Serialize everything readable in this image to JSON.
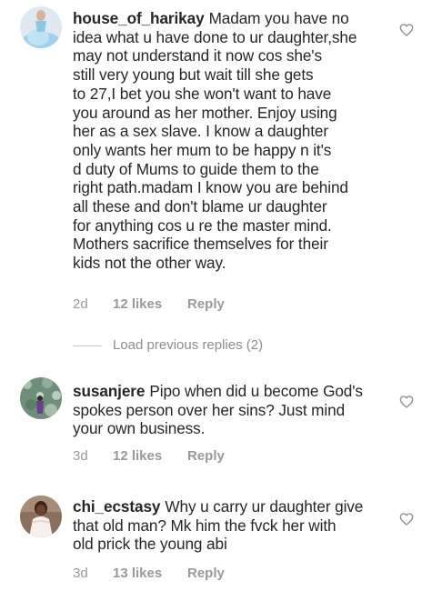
{
  "comments": [
    {
      "username": "house_of_harikay",
      "lines": [
        "Madam you have no",
        "idea what u have done to ur daughter,she",
        "may not understand it now cos she's",
        "still very young but wait till she gets",
        "to 27,I bet you she won't want to have",
        "you around as her mother. Enjoy using",
        "her as a sex slave. I know a daughter",
        "only wants her mum to be happy n it's",
        "d duty of Mums to guide them to the",
        "right path.madam I know you are behind",
        "all these and don't blame ur daughter",
        "for anything cos u re the master mind.",
        "Mothers sacrifice themselves for their",
        "kids not the other way."
      ],
      "time": "2d",
      "likes": "12 likes",
      "reply": "Reply",
      "avatar": "avatar-blue-gown",
      "heart_icon": "heart-outline-icon"
    },
    {
      "username": "susanjere",
      "lines": [
        "Pipo when did u become God's",
        "spokes person over her sins? Just mind",
        "your own business."
      ],
      "time": "3d",
      "likes": "12 likes",
      "reply": "Reply",
      "avatar": "avatar-floral",
      "heart_icon": "heart-outline-icon"
    },
    {
      "username": "chi_ecstasy",
      "lines": [
        "Why u carry ur daughter give",
        "that old man? Mk him the fvck her with",
        "old prick the young abi"
      ],
      "time": "3d",
      "likes": "13 likes",
      "reply": "Reply",
      "avatar": "avatar-white-dress",
      "heart_icon": "heart-outline-icon"
    }
  ],
  "load_previous": "Load previous replies (2)",
  "colors": {
    "text": "#262626",
    "meta": "#999999",
    "divider": "#c7c7c7"
  }
}
